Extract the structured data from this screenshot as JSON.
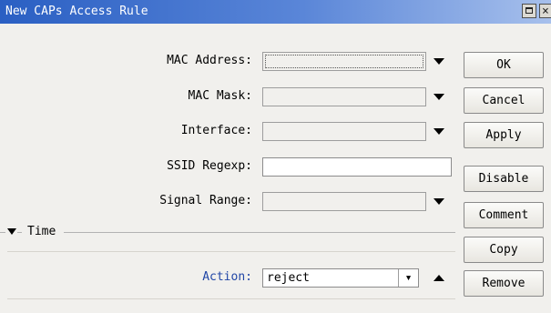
{
  "window": {
    "title": "New CAPs Access Rule",
    "close_glyph": "×"
  },
  "form": {
    "mac_address_label": "MAC Address:",
    "mac_mask_label": "MAC Mask:",
    "interface_label": "Interface:",
    "ssid_regexp_label": "SSID Regexp:",
    "signal_range_label": "Signal Range:",
    "action_label": "Action:",
    "action_value": "reject",
    "ssid_regexp_value": ""
  },
  "section": {
    "time_label": "Time"
  },
  "buttons": {
    "ok": "OK",
    "cancel": "Cancel",
    "apply": "Apply",
    "disable": "Disable",
    "comment": "Comment",
    "copy": "Copy",
    "remove": "Remove"
  },
  "colors": {
    "title_bar": "#2a5fc3",
    "action_label": "#2146a6",
    "background": "#f1f0ed"
  }
}
